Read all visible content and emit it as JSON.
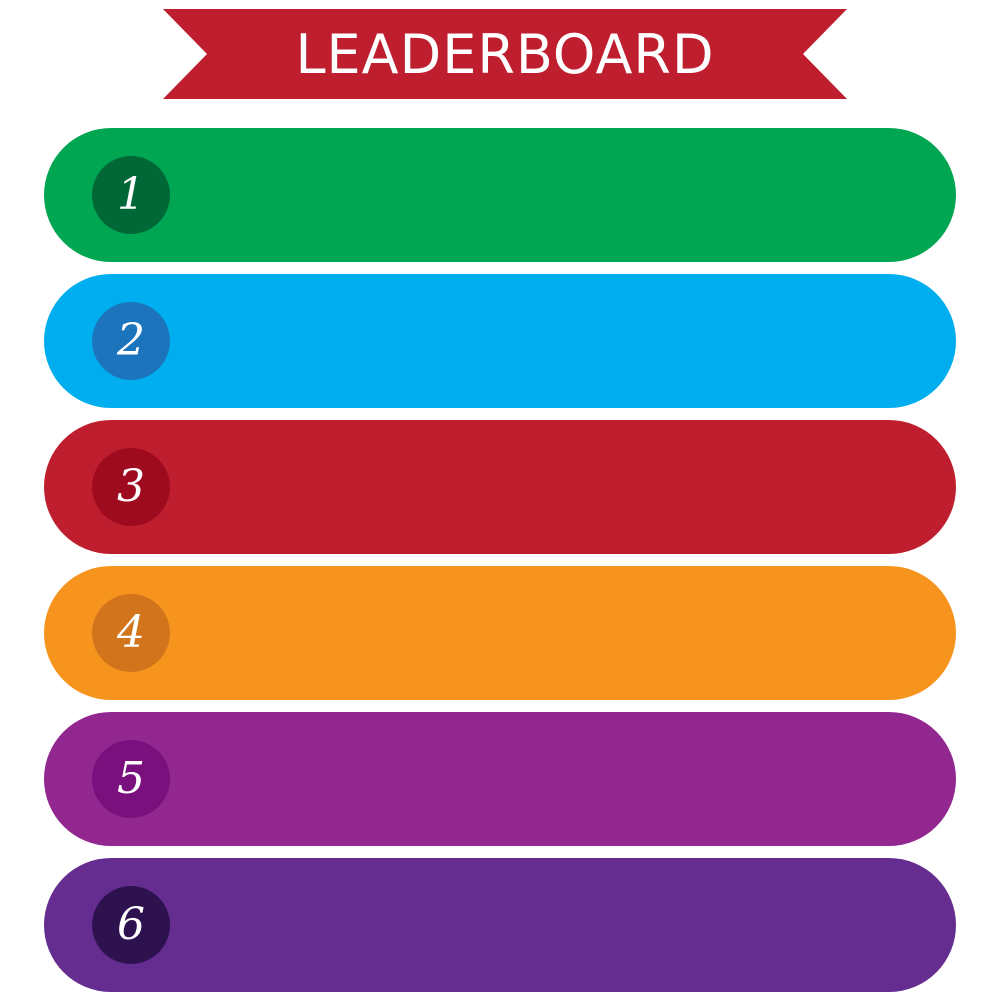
{
  "header": {
    "title": "LEADERBOARD",
    "ribbon_color": "#BE1E2D"
  },
  "rows": [
    {
      "rank": "1",
      "bar_color": "#00A651",
      "badge_color": "#006837"
    },
    {
      "rank": "2",
      "bar_color": "#00AEEF",
      "badge_color": "#1C75BC"
    },
    {
      "rank": "3",
      "bar_color": "#BE1E2D",
      "badge_color": "#9E0B1E"
    },
    {
      "rank": "4",
      "bar_color": "#F7941D",
      "badge_color": "#D2741C"
    },
    {
      "rank": "5",
      "bar_color": "#92278F",
      "badge_color": "#7A0F7E"
    },
    {
      "rank": "6",
      "bar_color": "#662D91",
      "badge_color": "#2E1250"
    }
  ]
}
